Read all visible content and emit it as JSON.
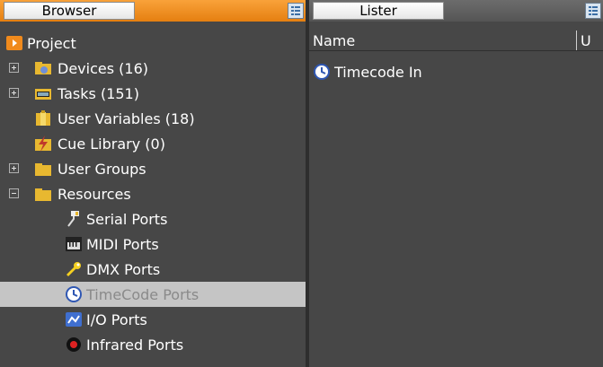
{
  "browser": {
    "title": "Browser",
    "tree": [
      {
        "label": "Project",
        "icon": "project-icon",
        "expander": "none"
      },
      {
        "label": "Devices (16)",
        "icon": "devices-icon",
        "expander": "plus"
      },
      {
        "label": "Tasks (151)",
        "icon": "tasks-icon",
        "expander": "plus"
      },
      {
        "label": "User Variables (18)",
        "icon": "user-variables-icon",
        "expander": "none"
      },
      {
        "label": "Cue Library (0)",
        "icon": "cue-library-icon",
        "expander": "none"
      },
      {
        "label": "User Groups",
        "icon": "folder-icon",
        "expander": "plus"
      },
      {
        "label": "Resources",
        "icon": "folder-icon",
        "expander": "minus"
      },
      {
        "label": "Serial Ports",
        "icon": "serial-port-icon"
      },
      {
        "label": "MIDI Ports",
        "icon": "midi-port-icon"
      },
      {
        "label": "DMX Ports",
        "icon": "dmx-port-icon"
      },
      {
        "label": "TimeCode Ports",
        "icon": "clock-icon",
        "selected": true
      },
      {
        "label": "I/O Ports",
        "icon": "io-port-icon"
      },
      {
        "label": "Infrared Ports",
        "icon": "infrared-port-icon"
      }
    ]
  },
  "lister": {
    "title": "Lister",
    "columns": [
      "Name",
      "U"
    ],
    "items": [
      {
        "label": "Timecode In",
        "icon": "clock-icon"
      }
    ]
  },
  "colors": {
    "accent_orange": "#f08a1c",
    "background": "#474747",
    "selected_row": "#c5c5c5"
  }
}
